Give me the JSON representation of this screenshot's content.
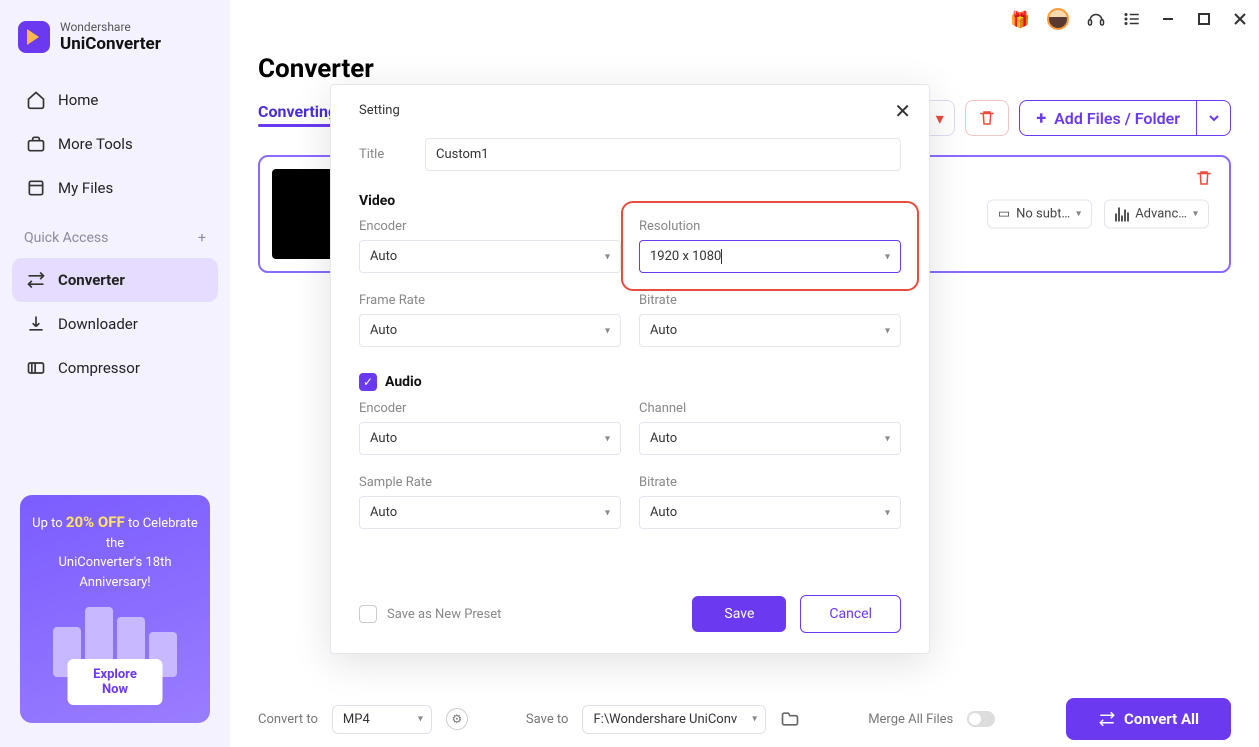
{
  "app": {
    "brand_top": "Wondershare",
    "brand_bottom": "UniConverter"
  },
  "sidebar": {
    "items": [
      {
        "label": "Home"
      },
      {
        "label": "More Tools"
      },
      {
        "label": "My Files"
      }
    ],
    "quick_label": "Quick Access",
    "quick_items": [
      {
        "label": "Converter"
      },
      {
        "label": "Downloader"
      },
      {
        "label": "Compressor"
      }
    ]
  },
  "promo": {
    "line1": "Up to ",
    "discount": "20% OFF",
    "line1b": " to Celebrate the",
    "line2": "UniConverter's 18th Anniversary!",
    "cta": "Explore Now"
  },
  "main": {
    "title": "Converter",
    "tab": "Converting",
    "add_files": "Add Files / Folder",
    "card_pills": {
      "subtitle": "No subt…",
      "advanced": "Advanc…"
    }
  },
  "bottom": {
    "convert_to": "Convert to",
    "format": "MP4",
    "save_to": "Save to",
    "path": "F:\\Wondershare UniConv",
    "merge": "Merge All Files",
    "convert_all": "Convert All"
  },
  "modal": {
    "heading": "Setting",
    "title_label": "Title",
    "title_value": "Custom1",
    "video_heading": "Video",
    "video": {
      "encoder": {
        "label": "Encoder",
        "value": "Auto"
      },
      "resolution": {
        "label": "Resolution",
        "value": "1920 x 1080"
      },
      "framerate": {
        "label": "Frame Rate",
        "value": "Auto"
      },
      "bitrate": {
        "label": "Bitrate",
        "value": "Auto"
      }
    },
    "audio_heading": "Audio",
    "audio_checked": true,
    "audio": {
      "encoder": {
        "label": "Encoder",
        "value": "Auto"
      },
      "channel": {
        "label": "Channel",
        "value": "Auto"
      },
      "samplerate": {
        "label": "Sample Rate",
        "value": "Auto"
      },
      "bitrate": {
        "label": "Bitrate",
        "value": "Auto"
      }
    },
    "save_preset": "Save as New Preset",
    "save": "Save",
    "cancel": "Cancel"
  }
}
